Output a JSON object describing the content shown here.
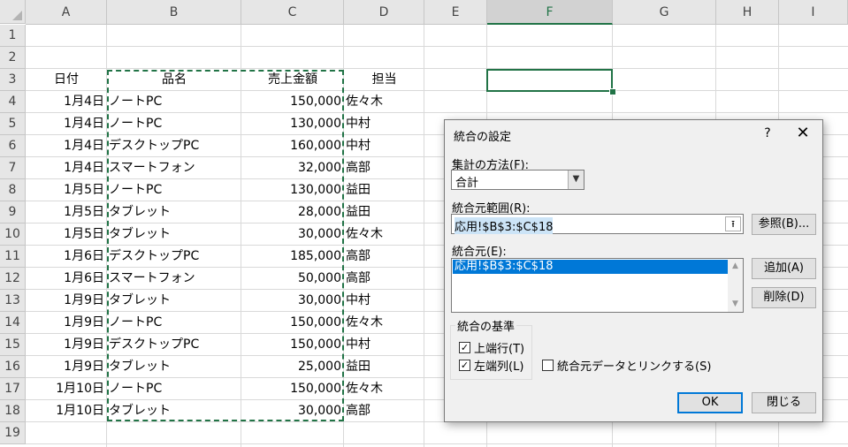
{
  "sheet": {
    "columns": [
      "A",
      "B",
      "C",
      "D",
      "E",
      "F",
      "G",
      "H",
      "I"
    ],
    "selected_column": "F",
    "rows": [
      "1",
      "2",
      "3",
      "4",
      "5",
      "6",
      "7",
      "8",
      "9",
      "10",
      "11",
      "12",
      "13",
      "14",
      "15",
      "16",
      "17",
      "18",
      "19"
    ],
    "headers": {
      "date": "日付",
      "item": "品名",
      "sales": "売上金額",
      "person": "担当"
    },
    "data": [
      {
        "date": "1月4日",
        "item": "ノートPC",
        "sales": "150,000",
        "person": "佐々木"
      },
      {
        "date": "1月4日",
        "item": "ノートPC",
        "sales": "130,000",
        "person": "中村"
      },
      {
        "date": "1月4日",
        "item": "デスクトップPC",
        "sales": "160,000",
        "person": "中村"
      },
      {
        "date": "1月4日",
        "item": "スマートフォン",
        "sales": "32,000",
        "person": "高部"
      },
      {
        "date": "1月5日",
        "item": "ノートPC",
        "sales": "130,000",
        "person": "益田"
      },
      {
        "date": "1月5日",
        "item": "タブレット",
        "sales": "28,000",
        "person": "益田"
      },
      {
        "date": "1月5日",
        "item": "タブレット",
        "sales": "30,000",
        "person": "佐々木"
      },
      {
        "date": "1月6日",
        "item": "デスクトップPC",
        "sales": "185,000",
        "person": "高部"
      },
      {
        "date": "1月6日",
        "item": "スマートフォン",
        "sales": "50,000",
        "person": "高部"
      },
      {
        "date": "1月9日",
        "item": "タブレット",
        "sales": "30,000",
        "person": "中村"
      },
      {
        "date": "1月9日",
        "item": "ノートPC",
        "sales": "150,000",
        "person": "佐々木"
      },
      {
        "date": "1月9日",
        "item": "デスクトップPC",
        "sales": "150,000",
        "person": "中村"
      },
      {
        "date": "1月9日",
        "item": "タブレット",
        "sales": "25,000",
        "person": "益田"
      },
      {
        "date": "1月10日",
        "item": "ノートPC",
        "sales": "150,000",
        "person": "佐々木"
      },
      {
        "date": "1月10日",
        "item": "タブレット",
        "sales": "30,000",
        "person": "高部"
      }
    ]
  },
  "dialog": {
    "title": "統合の設定",
    "help": "?",
    "close": "✕",
    "function_label": "集計の方法(F):",
    "function_value": "合計",
    "reference_label": "統合元範囲(R):",
    "reference_value": "応用!$B$3:$C$18",
    "browse_button": "参照(B)...",
    "all_refs_label": "統合元(E):",
    "all_refs_items": [
      "応用!$B$3:$C$18"
    ],
    "add_button": "追加(A)",
    "delete_button": "削除(D)",
    "labels_group": "統合の基準",
    "top_row": {
      "label": "上端行(T)",
      "checked": true
    },
    "left_col": {
      "label": "左端列(L)",
      "checked": true
    },
    "link_source": {
      "label": "統合元データとリンクする(S)",
      "checked": false
    },
    "ok_button": "OK",
    "close_button": "閉じる"
  },
  "colors": {
    "accent": "#217346",
    "selection": "#0078d7"
  }
}
